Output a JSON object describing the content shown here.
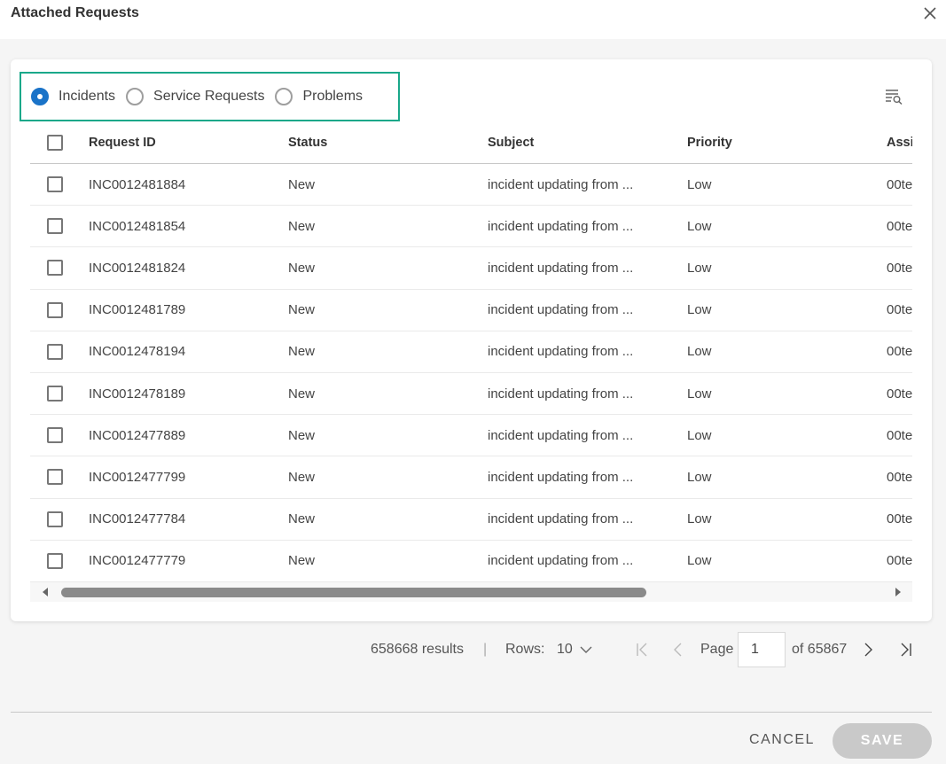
{
  "dialog": {
    "title": "Attached Requests",
    "close_icon": "close-icon"
  },
  "type_filter": {
    "options": [
      {
        "label": "Incidents",
        "checked": true
      },
      {
        "label": "Service Requests",
        "checked": false
      },
      {
        "label": "Problems",
        "checked": false
      }
    ]
  },
  "toolbar": {
    "filter_icon": "filter-list-icon"
  },
  "table": {
    "columns": [
      "Request ID",
      "Status",
      "Subject",
      "Priority",
      "Assig"
    ],
    "rows": [
      {
        "id": "INC0012481884",
        "status": "New",
        "subject": "incident updating from ...",
        "priority": "Low",
        "assignee": "00te"
      },
      {
        "id": "INC0012481854",
        "status": "New",
        "subject": "incident updating from ...",
        "priority": "Low",
        "assignee": "00te"
      },
      {
        "id": "INC0012481824",
        "status": "New",
        "subject": "incident updating from ...",
        "priority": "Low",
        "assignee": "00te"
      },
      {
        "id": "INC0012481789",
        "status": "New",
        "subject": "incident updating from ...",
        "priority": "Low",
        "assignee": "00te"
      },
      {
        "id": "INC0012478194",
        "status": "New",
        "subject": "incident updating from ...",
        "priority": "Low",
        "assignee": "00te"
      },
      {
        "id": "INC0012478189",
        "status": "New",
        "subject": "incident updating from ...",
        "priority": "Low",
        "assignee": "00te"
      },
      {
        "id": "INC0012477889",
        "status": "New",
        "subject": "incident updating from ...",
        "priority": "Low",
        "assignee": "00te"
      },
      {
        "id": "INC0012477799",
        "status": "New",
        "subject": "incident updating from ...",
        "priority": "Low",
        "assignee": "00te"
      },
      {
        "id": "INC0012477784",
        "status": "New",
        "subject": "incident updating from ...",
        "priority": "Low",
        "assignee": "00te"
      },
      {
        "id": "INC0012477779",
        "status": "New",
        "subject": "incident updating from ...",
        "priority": "Low",
        "assignee": "00te"
      }
    ]
  },
  "pagination": {
    "results": "658668 results",
    "separator": "|",
    "rows_label": "Rows:",
    "rows_value": "10",
    "page_label": "Page",
    "page_value": "1",
    "of_label": "of 65867"
  },
  "footer": {
    "cancel_label": "CANCEL",
    "save_label": "SAVE"
  },
  "colors": {
    "accent": "#1a73c8",
    "filter_border": "#1aa88a",
    "save_disabled": "#c9c9c9"
  }
}
